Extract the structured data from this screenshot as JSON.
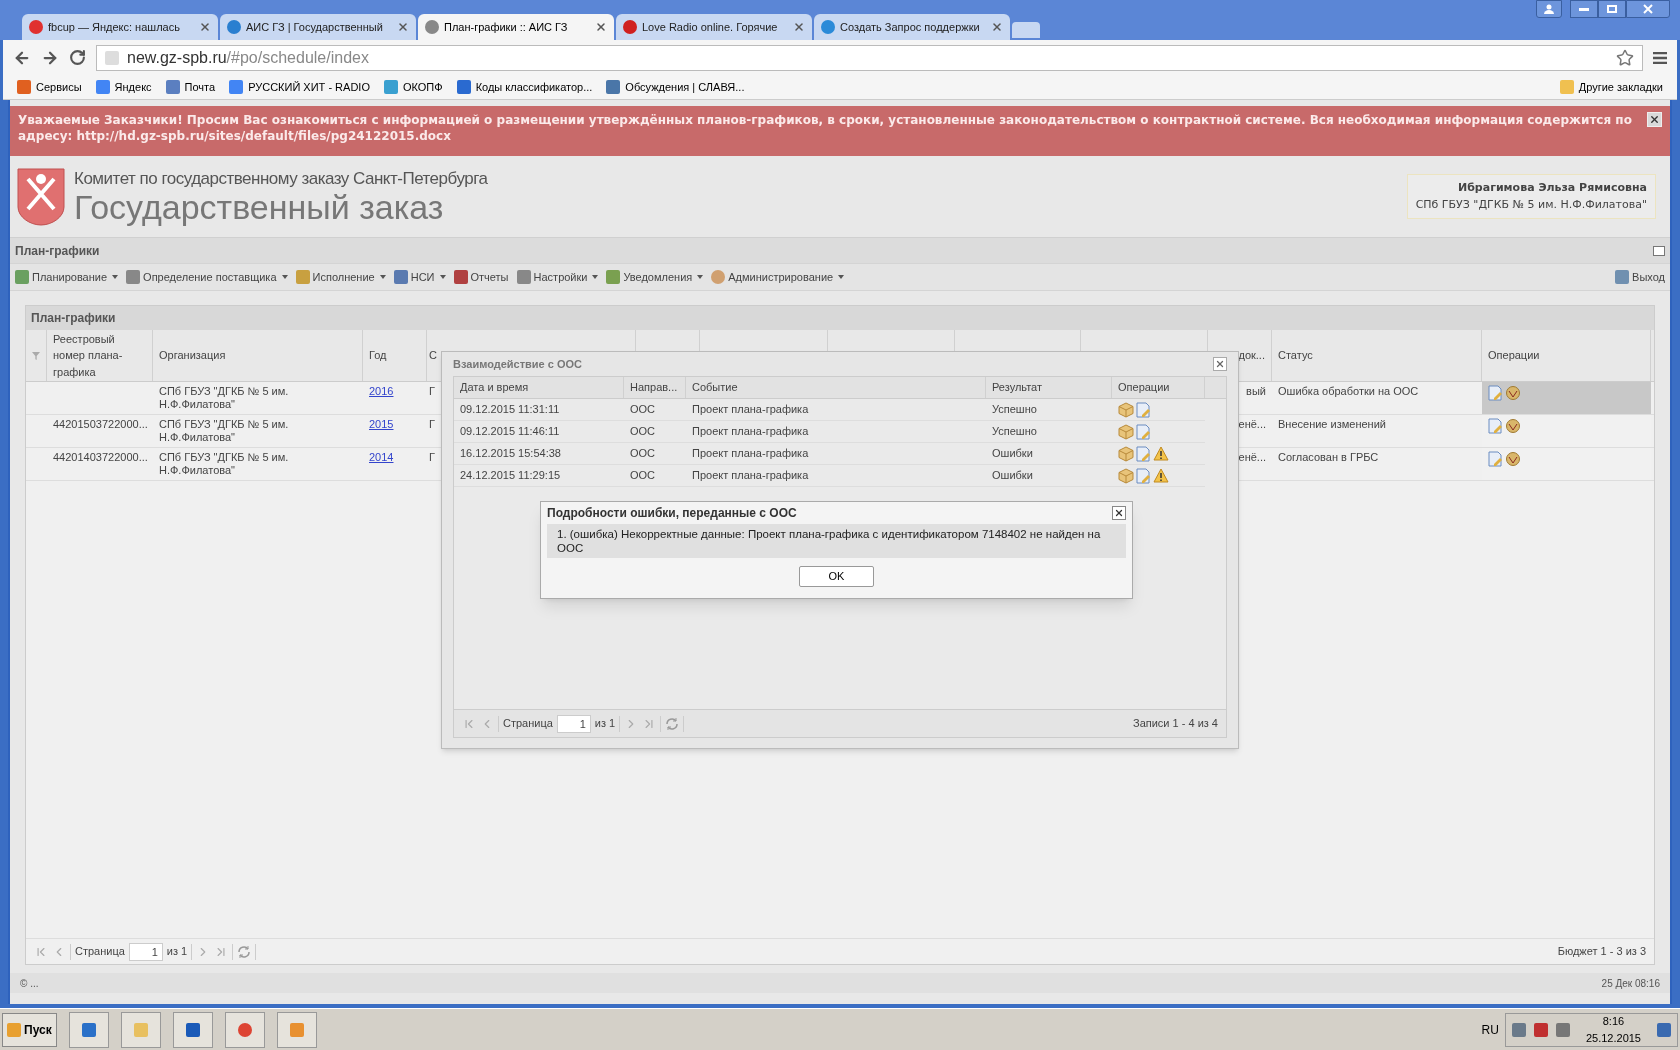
{
  "browser": {
    "tabs": [
      {
        "title": "fbcup — Яндекс: нашлась",
        "selected": false
      },
      {
        "title": "АИС ГЗ | Государственный",
        "selected": false
      },
      {
        "title": "План-графики :: АИС ГЗ",
        "selected": true
      },
      {
        "title": "Love Radio online. Горячие",
        "selected": false
      },
      {
        "title": "Создать Запрос поддержки",
        "selected": false
      }
    ],
    "address": {
      "host": "new.gz-spb.ru",
      "path": "/#po/schedule/index"
    },
    "bookmarks": [
      "Сервисы",
      "Яндекс",
      "Почта",
      "РУССКИЙ ХИТ - RADIO",
      "ОКОПФ",
      "Коды классификатор...",
      "Обсуждения | СЛАВЯ..."
    ],
    "other_bookmarks": "Другие закладки"
  },
  "banner": {
    "text": "Уважаемые Заказчики! Просим Вас ознакомиться с информацией о размещении утверждённых планов-графиков, в сроки, установленные законодательством о контрактной системе. Вся необходимая информация содержится по адресу: http://hd.gz-spb.ru/sites/default/files/pg24122015.docx"
  },
  "header": {
    "committee": "Комитет по государственному заказу Санкт-Петербурга",
    "title": "Государственный заказ",
    "user": {
      "name": "Ибрагимова Эльза Рямисовна",
      "org": "СПб ГБУЗ \"ДГКБ № 5 им. Н.Ф.Филатова\""
    }
  },
  "panel_title": "План-графики",
  "menu": [
    {
      "label": "Планирование",
      "dropdown": true
    },
    {
      "label": "Определение поставщика",
      "dropdown": true
    },
    {
      "label": "Исполнение",
      "dropdown": true
    },
    {
      "label": "НСИ",
      "dropdown": true
    },
    {
      "label": "Отчеты",
      "dropdown": false
    },
    {
      "label": "Настройки",
      "dropdown": true
    },
    {
      "label": "Уведомления",
      "dropdown": true
    },
    {
      "label": "Администрирование",
      "dropdown": true
    }
  ],
  "logout": "Выход",
  "grid": {
    "title": "План-графики",
    "columns": {
      "reg": "Реестровый номер плана-графика",
      "org": "Организация",
      "year": "Год",
      "column_5": "С",
      "column_10": "док...",
      "status": "Статус",
      "ops": "Операции"
    },
    "rows": [
      {
        "reg": "",
        "org": "СПб ГБУЗ \"ДГКБ № 5 им. Н.Ф.Филатова\"",
        "year": "2016",
        "column_5": "Г",
        "column_10": "вый",
        "status": "Ошибка обработки на ООС",
        "selected": true
      },
      {
        "reg": "44201503722000...",
        "org": "СПб ГБУЗ \"ДГКБ № 5 им. Н.Ф.Филатова\"",
        "year": "2015",
        "column_5": "Г",
        "column_10": "енё...",
        "status": "Внесение изменений",
        "selected": false
      },
      {
        "reg": "44201403722000...",
        "org": "СПб ГБУЗ \"ДГКБ № 5 им. Н.Ф.Филатова\"",
        "year": "2014",
        "column_5": "Г",
        "column_10": "енё...",
        "status": "Согласован в ГРБС",
        "selected": false
      }
    ],
    "pager": {
      "page_label": "Страница",
      "page": "1",
      "of": "из 1",
      "summary": "Бюджет 1 - 3 из 3"
    }
  },
  "footer": {
    "copyright": "© ...",
    "datetime": "25 Дек 08:16"
  },
  "dialog": {
    "title": "Взаимодействие с ООС",
    "columns": [
      "Дата и время",
      "Направ...",
      "Событие",
      "Результат",
      "Операции"
    ],
    "rows": [
      {
        "datetime": "09.12.2015 11:31:11",
        "direction": "ООС",
        "event": "Проект плана-графика",
        "result": "Успешно",
        "has_error": false
      },
      {
        "datetime": "09.12.2015 11:46:11",
        "direction": "ООС",
        "event": "Проект плана-графика",
        "result": "Успешно",
        "has_error": false
      },
      {
        "datetime": "16.12.2015 15:54:38",
        "direction": "ООС",
        "event": "Проект плана-графика",
        "result": "Ошибки",
        "has_error": true
      },
      {
        "datetime": "24.12.2015 11:29:15",
        "direction": "ООС",
        "event": "Проект плана-графика",
        "result": "Ошибки",
        "has_error": true
      }
    ],
    "pager": {
      "page_label": "Страница",
      "page": "1",
      "of": "из 1",
      "summary": "Записи 1 - 4 из 4"
    }
  },
  "error_dialog": {
    "title": "Подробности ошибки, переданные с ООС",
    "message": "1. (ошибка) Некорректные данные: Проект плана-графика с идентификатором 7148402 не найден на ООС",
    "ok": "OK"
  },
  "taskbar": {
    "start": "Пуск",
    "lang": "RU",
    "time": "8:16",
    "date": "25.12.2015"
  }
}
